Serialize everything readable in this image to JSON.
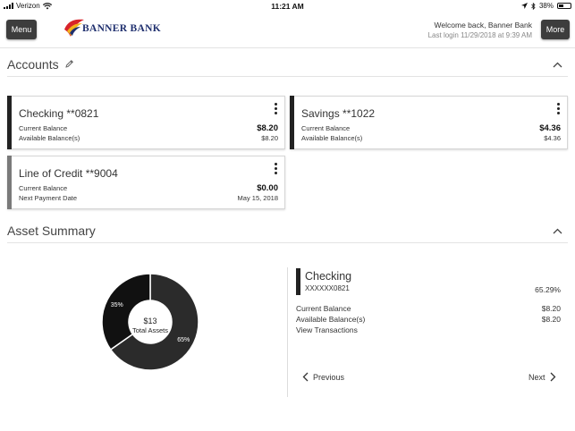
{
  "status_bar": {
    "carrier": "Verizon",
    "time": "11:21 AM",
    "battery": "38%"
  },
  "header": {
    "menu_label": "Menu",
    "more_label": "More",
    "logo_text": "BANNER BANK",
    "welcome": "Welcome back, Banner Bank",
    "last_login": "Last login 11/29/2018 at 9:39 AM"
  },
  "accounts_section": {
    "title": "Accounts",
    "cards": [
      {
        "name": "Checking **0821",
        "row1_label": "Current Balance",
        "row1_value": "$8.20",
        "row2_label": "Available Balance(s)",
        "row2_value": "$8.20"
      },
      {
        "name": "Savings **1022",
        "row1_label": "Current Balance",
        "row1_value": "$4.36",
        "row2_label": "Available Balance(s)",
        "row2_value": "$4.36"
      },
      {
        "name": "Line of Credit **9004",
        "row1_label": "Current Balance",
        "row1_value": "$0.00",
        "row2_label": "Next Payment Date",
        "row2_value": "May 15, 2018"
      }
    ]
  },
  "asset_summary": {
    "title": "Asset Summary",
    "chart": {
      "center_value": "$13",
      "center_label": "Total Assets",
      "slices": [
        {
          "label": "65%",
          "percent": 65.29,
          "color": "#2b2b2b"
        },
        {
          "label": "35%",
          "percent": 34.71,
          "color": "#111111"
        }
      ]
    },
    "detail": {
      "name": "Checking",
      "account": "XXXXXX0821",
      "percent": "65.29%",
      "current_balance_label": "Current Balance",
      "current_balance_value": "$8.20",
      "available_balance_label": "Available Balance(s)",
      "available_balance_value": "$8.20",
      "view_transactions": "View Transactions"
    },
    "nav": {
      "previous": "Previous",
      "next": "Next"
    }
  },
  "colors": {
    "brand_navy": "#1f2f6e",
    "brand_red": "#d8232a",
    "brand_yellow": "#f2b21c",
    "button_dark": "#3d3d3d"
  }
}
